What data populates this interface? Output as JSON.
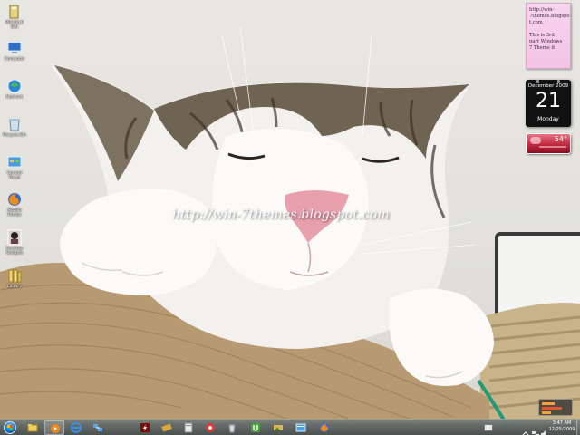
{
  "wallpaper": {
    "watermark": "http://win-7themes.blogspot.com"
  },
  "desktop_icons": [
    {
      "label": "RECYCLE BIN",
      "icon": "recycle-bin-icon"
    },
    {
      "label": "Computer",
      "icon": "computer-icon"
    },
    {
      "label": "Network",
      "icon": "network-globe-icon"
    },
    {
      "label": "Recycle Bin",
      "icon": "recycle-bin-icon"
    },
    {
      "label": "Control Panel",
      "icon": "control-panel-icon"
    },
    {
      "label": "Mozilla Firefox",
      "icon": "firefox-icon"
    },
    {
      "label": "Desktop Gadgets",
      "icon": "avatar-icon"
    },
    {
      "label": "Library",
      "icon": "library-folder-icon"
    }
  ],
  "gadgets": {
    "note_text": "http://win-\n7themes.blogspo\nt.com\n\nThis is 3rd\npart Windows\n7 Theme it",
    "calendar": {
      "month": "December 2009",
      "day": "21",
      "weekday": "Monday"
    },
    "weather": {
      "temperature": "54°"
    }
  },
  "taskbar": {
    "items": [
      {
        "icon": "explorer-folder-icon",
        "active": false
      },
      {
        "icon": "media-player-icon",
        "active": true
      },
      {
        "icon": "internet-explorer-icon",
        "active": false
      },
      {
        "icon": "network-icon",
        "active": false
      },
      {
        "icon": "flash-icon",
        "active": false
      },
      {
        "icon": "media-center-icon",
        "active": false
      },
      {
        "icon": "application-icon",
        "active": false
      },
      {
        "icon": "media-icon",
        "active": false
      },
      {
        "icon": "recycle-icon",
        "active": false
      },
      {
        "icon": "utorrent-icon",
        "active": false
      },
      {
        "icon": "pictures-icon",
        "active": false
      },
      {
        "icon": "explorer-icon",
        "active": false
      },
      {
        "icon": "firefox-icon",
        "active": false
      }
    ],
    "clock": {
      "time": "3:47 AM",
      "date": "12/25/2009"
    }
  }
}
